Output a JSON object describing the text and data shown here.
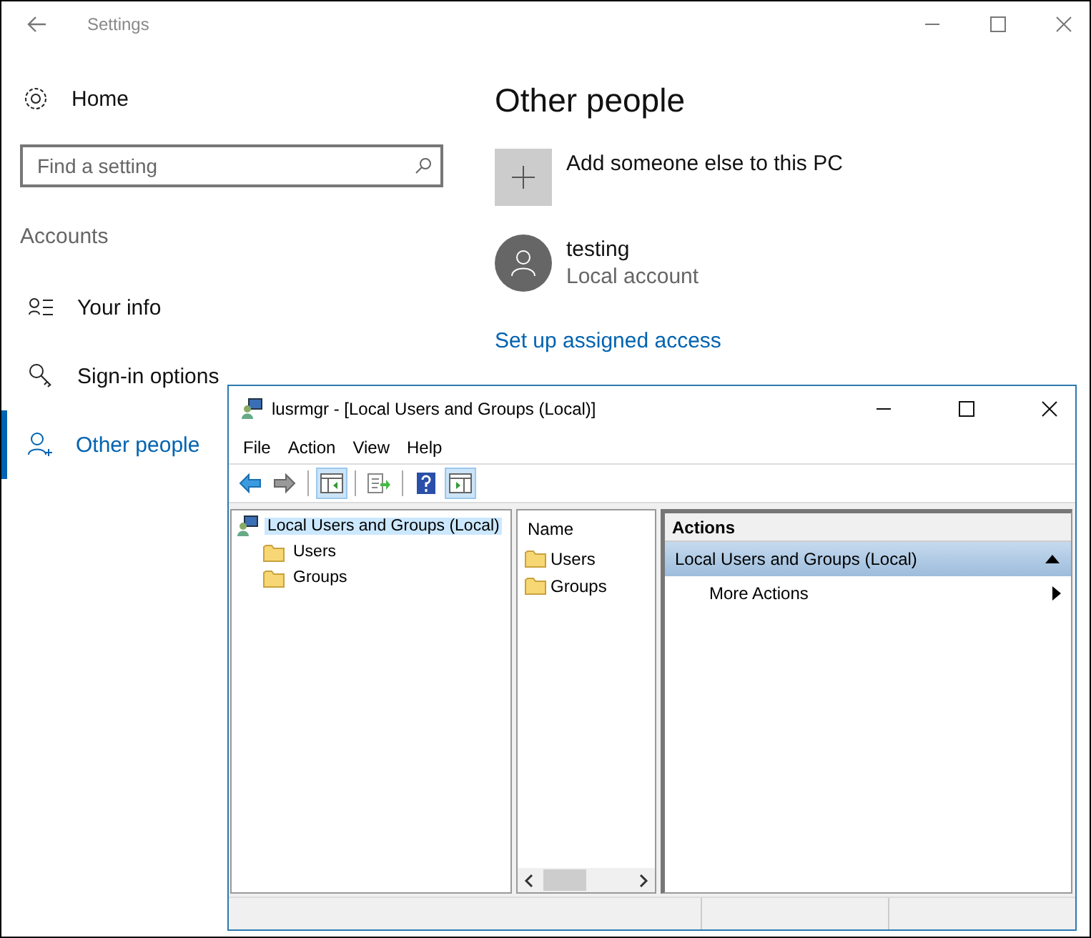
{
  "settings": {
    "title": "Settings",
    "home": "Home",
    "search": {
      "placeholder": "Find a setting"
    },
    "section": "Accounts",
    "nav": [
      {
        "label": "Your info",
        "kind": "info",
        "selected": false
      },
      {
        "label": "Sign-in options",
        "kind": "key",
        "selected": false
      },
      {
        "label": "Other people",
        "kind": "people",
        "selected": true
      }
    ],
    "heading": "Other people",
    "add_label": "Add someone else to this PC",
    "account": {
      "name": "testing",
      "type": "Local account"
    },
    "link": "Set up assigned access"
  },
  "mmc": {
    "title": "lusrmgr - [Local Users and Groups (Local)]",
    "menu": [
      "File",
      "Action",
      "View",
      "Help"
    ],
    "toolbar": [
      {
        "kind": "back",
        "pressed": false
      },
      {
        "kind": "forward",
        "pressed": false
      },
      {
        "kind": "tree",
        "pressed": true
      },
      {
        "kind": "export",
        "pressed": false
      },
      {
        "kind": "help",
        "pressed": false
      },
      {
        "kind": "actions",
        "pressed": true
      }
    ],
    "tree": {
      "label": "Local Users and Groups (Local)",
      "selected": true,
      "children": [
        {
          "label": "Users",
          "selected": false
        },
        {
          "label": "Groups",
          "selected": false
        }
      ]
    },
    "list": {
      "column": "Name",
      "items": [
        "Users",
        "Groups"
      ]
    },
    "actions": {
      "header": "Actions",
      "group": "Local Users and Groups (Local)",
      "items": [
        "More Actions"
      ]
    }
  }
}
